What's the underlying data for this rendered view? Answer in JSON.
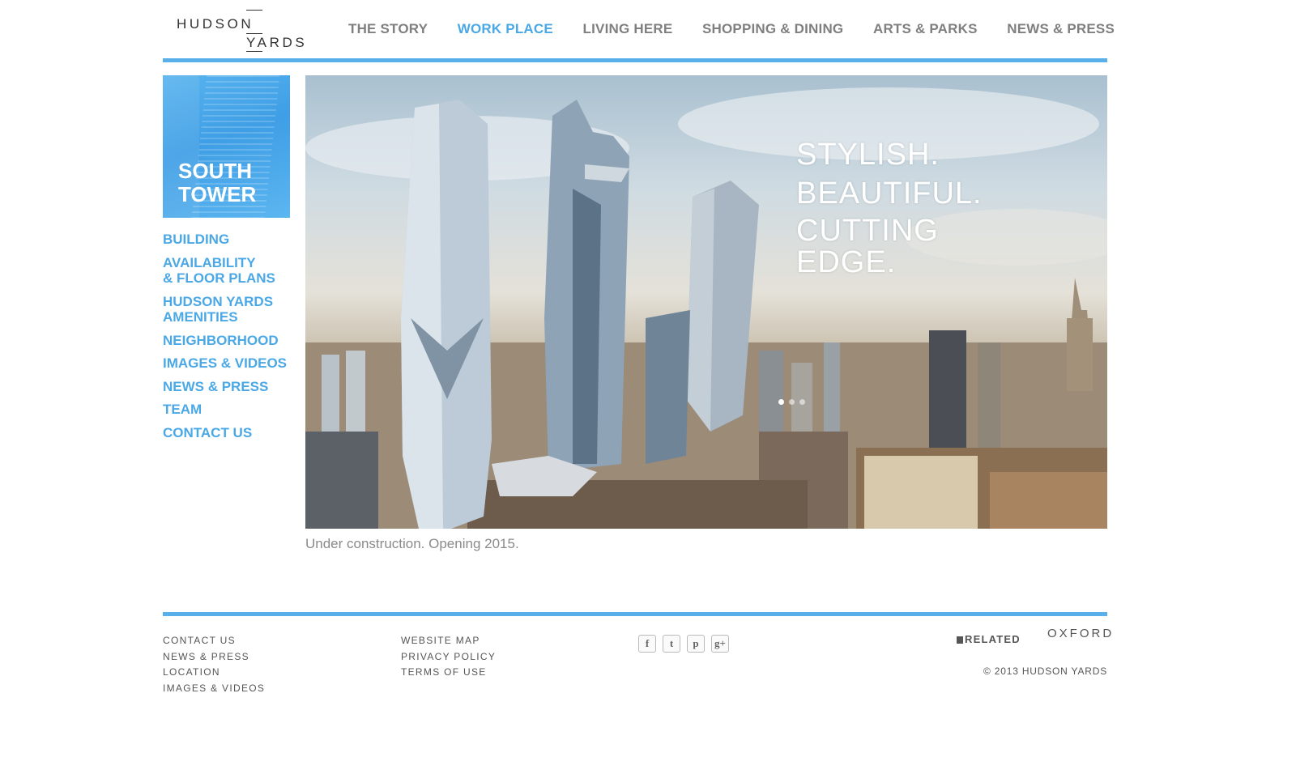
{
  "brand": {
    "logo_line1": "HUDSON",
    "logo_line2": "YARDS"
  },
  "topnav": {
    "items": [
      {
        "label": "THE STORY"
      },
      {
        "label": "WORK PLACE",
        "active": true
      },
      {
        "label": "LIVING HERE"
      },
      {
        "label": "SHOPPING & DINING"
      },
      {
        "label": "ARTS & PARKS"
      },
      {
        "label": "NEWS & PRESS"
      }
    ]
  },
  "sidebar": {
    "tile_title_line1": "SOUTH",
    "tile_title_line2": "TOWER",
    "items": [
      {
        "label": "BUILDING"
      },
      {
        "label_line1": "AVAILABILITY",
        "label_line2": "& FLOOR PLANS"
      },
      {
        "label_line1": "HUDSON YARDS",
        "label_line2": "AMENITIES"
      },
      {
        "label": "NEIGHBORHOOD"
      },
      {
        "label": "IMAGES & VIDEOS"
      },
      {
        "label": "NEWS & PRESS"
      },
      {
        "label": "TEAM"
      },
      {
        "label": "CONTACT US"
      }
    ]
  },
  "hero": {
    "slogan": [
      "STYLISH.",
      "BEAUTIFUL.",
      "CUTTING",
      "EDGE."
    ],
    "slides_total": 3,
    "active_slide": 1
  },
  "caption": "Under construction. Opening 2015.",
  "footer": {
    "col1": [
      "CONTACT US",
      "NEWS & PRESS",
      "LOCATION",
      "IMAGES & VIDEOS"
    ],
    "col2": [
      "WEBSITE MAP",
      "PRIVACY POLICY",
      "TERMS OF USE"
    ],
    "social_icons": [
      "facebook-icon",
      "twitter-icon",
      "pinterest-icon",
      "google-plus-icon"
    ],
    "social_glyphs": [
      "f",
      "t",
      "p",
      "g+"
    ],
    "partner1": "RELATED",
    "partner2": "OXFORD",
    "copyright": "© 2013 HUDSON YARDS"
  },
  "colors": {
    "accent": "#4aa8e6",
    "rule": "#58b0ea",
    "nav_gray": "#7f7f7f"
  }
}
